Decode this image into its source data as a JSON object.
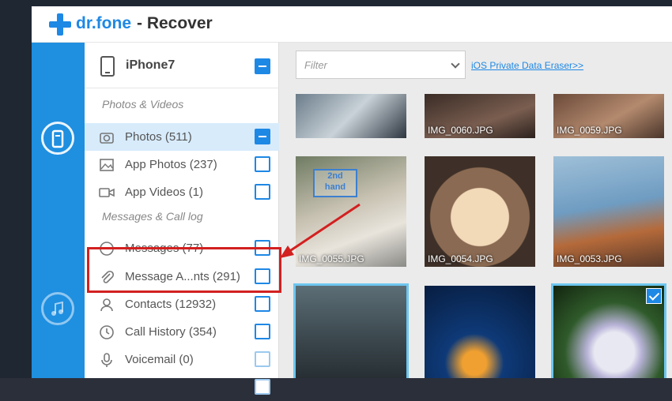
{
  "app": {
    "brand": "dr.fone",
    "title": "- Recover"
  },
  "device": {
    "name": "iPhone7"
  },
  "sections": {
    "photos_videos": "Photos & Videos",
    "messages_calllog": "Messages & Call log"
  },
  "items": {
    "photos": "Photos (511)",
    "app_photos": "App Photos (237)",
    "app_videos": "App Videos (1)",
    "messages": "Messages (77)",
    "attachments": "Message A...nts (291)",
    "contacts": "Contacts (12932)",
    "call_history": "Call History (354)",
    "voicemail": "Voicemail (0)"
  },
  "filter": {
    "placeholder": "Filter"
  },
  "link": {
    "eraser": "iOS Private Data Eraser>>"
  },
  "thumbnails": {
    "t1": "",
    "t2": "IMG_0060.JPG",
    "t3": "IMG_0059.JPG",
    "t4": "IMG_0055.JPG",
    "t5": "IMG_0054.JPG",
    "t6": "IMG_0053.JPG"
  },
  "watermark": "2nd\nhand",
  "colors": {
    "accent": "#1e88e5",
    "rail": "#1f8fe0",
    "highlight": "#d32020"
  }
}
